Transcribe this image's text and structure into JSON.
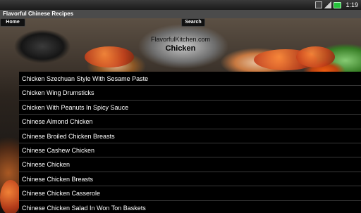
{
  "status_bar": {
    "time": "1:19",
    "time_suffix": "⏰",
    "icons": [
      "network-icon",
      "signal-icon",
      "battery-icon"
    ]
  },
  "app": {
    "title": "Flavorful Chinese Recipes"
  },
  "nav": {
    "home_label": "Home",
    "search_label": "Search"
  },
  "header": {
    "site_name": "FlavorfulKitchen.com",
    "category": "Chicken"
  },
  "recipes": [
    "Chicken Szechuan Style With Sesame Paste",
    "Chicken Wing Drumsticks",
    "Chicken With Peanuts In Spicy Sauce",
    "Chinese Almond Chicken",
    "Chinese Broiled Chicken Breasts",
    "Chinese Cashew Chicken",
    "Chinese Chicken",
    "Chinese Chicken Breasts",
    "Chinese Chicken Casserole",
    "Chinese Chicken Salad In Won Ton Baskets"
  ],
  "colors": {
    "status_bar": "#1a1a1a",
    "title_bar": "#4b4b4b",
    "list_bg": "#000000",
    "list_text": "#ffffff",
    "battery": "#25c23b"
  }
}
